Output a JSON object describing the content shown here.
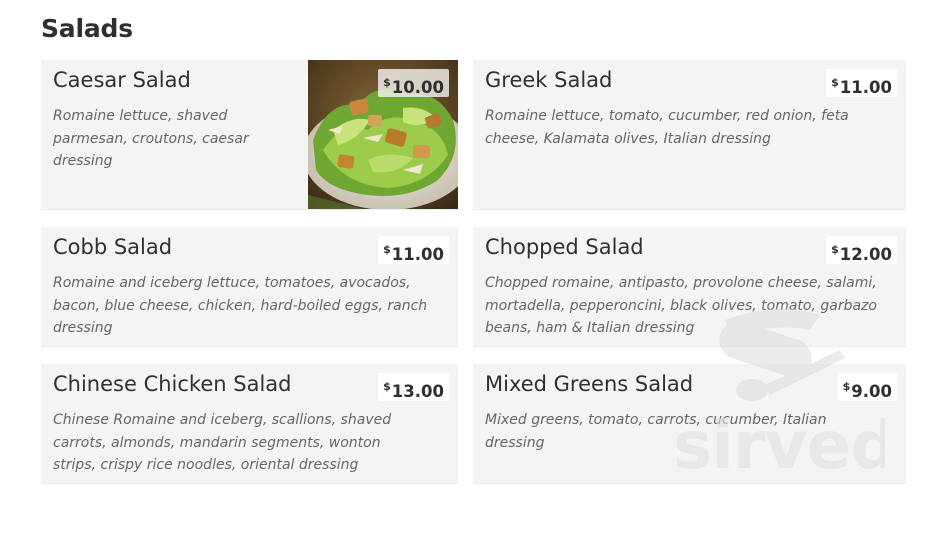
{
  "section": {
    "title": "Salads"
  },
  "currency_symbol": "$",
  "items": [
    {
      "name": "Caesar Salad",
      "description": "Romaine lettuce, shaved parmesan, croutons, caesar dressing",
      "price": "10.00",
      "has_photo": true
    },
    {
      "name": "Greek Salad",
      "description": "Romaine lettuce, tomato, cucumber, red onion, feta cheese, Kalamata olives, Italian dressing",
      "price": "11.00"
    },
    {
      "name": "Cobb Salad",
      "description": "Romaine and iceberg lettuce, tomatoes, avocados, bacon, blue cheese, chicken, hard-boiled eggs, ranch dressing",
      "price": "11.00"
    },
    {
      "name": "Chopped Salad",
      "description": "Chopped romaine, antipasto, provolone cheese, salami, mortadella, pepperoncini, black olives, tomato, garbazo beans, ham & Italian dressing",
      "price": "12.00"
    },
    {
      "name": "Chinese Chicken Salad",
      "description": "Chinese Romaine and iceberg, scallions, shaved carrots, almonds, mandarin segments, wonton strips, crispy rice noodles, oriental dressing",
      "price": "13.00"
    },
    {
      "name": "Mixed Greens Salad",
      "description": "Mixed greens, tomato, carrots, cucumber, Italian dressing",
      "price": "9.00"
    }
  ],
  "watermark": {
    "text": "sirved",
    "icon": "swiss-army-knife-icon"
  },
  "colors": {
    "card_background": "#f4f4f4",
    "title_text": "#2f2f2f",
    "description_text": "#666666"
  }
}
